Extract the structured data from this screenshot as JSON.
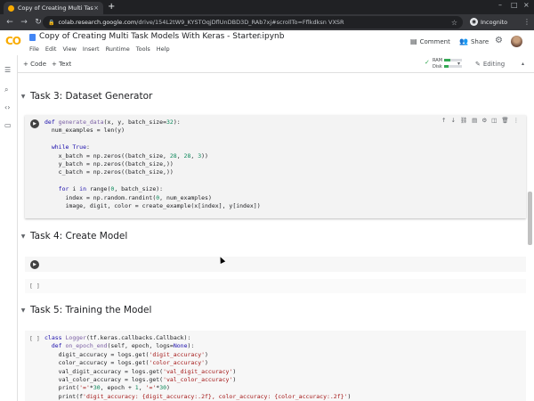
{
  "browser": {
    "tab_title": "Copy of Creating Multi Tas",
    "tab_close": "×",
    "new_tab": "+",
    "url_host": "colab.research.google.com",
    "url_path": "/drive/154L2tW9_KYSTOqjDflUnDBD3D_RAb7xj#scrollTo=Fflkdksn VXSR",
    "profile": "Incognito",
    "icons": [
      "back-arrow-icon",
      "forward-arrow-icon",
      "reload-icon",
      "lock-icon",
      "star-icon",
      "incognito-icon",
      "menu-dots-icon"
    ]
  },
  "colab": {
    "logo": "CO",
    "title": "Copy of Creating Multi Task Models With Keras - Starter.ipynb",
    "menu": [
      "File",
      "Edit",
      "View",
      "Insert",
      "Runtime",
      "Tools",
      "Help"
    ],
    "comment": "Comment",
    "share": "Share",
    "toolbar": {
      "add_code": "+ Code",
      "add_text": "+ Text",
      "ram": "RAM",
      "disk": "Disk",
      "ram_level": 0.35,
      "disk_level": 0.25,
      "editing": "Editing"
    },
    "sections": [
      {
        "title": "Task 3: Dataset Generator"
      },
      {
        "title": "Task 4: Create Model"
      },
      {
        "title": "Task 5: Training the Model"
      }
    ],
    "empty_cell": "[ ]",
    "accent": "#f9ab00"
  }
}
